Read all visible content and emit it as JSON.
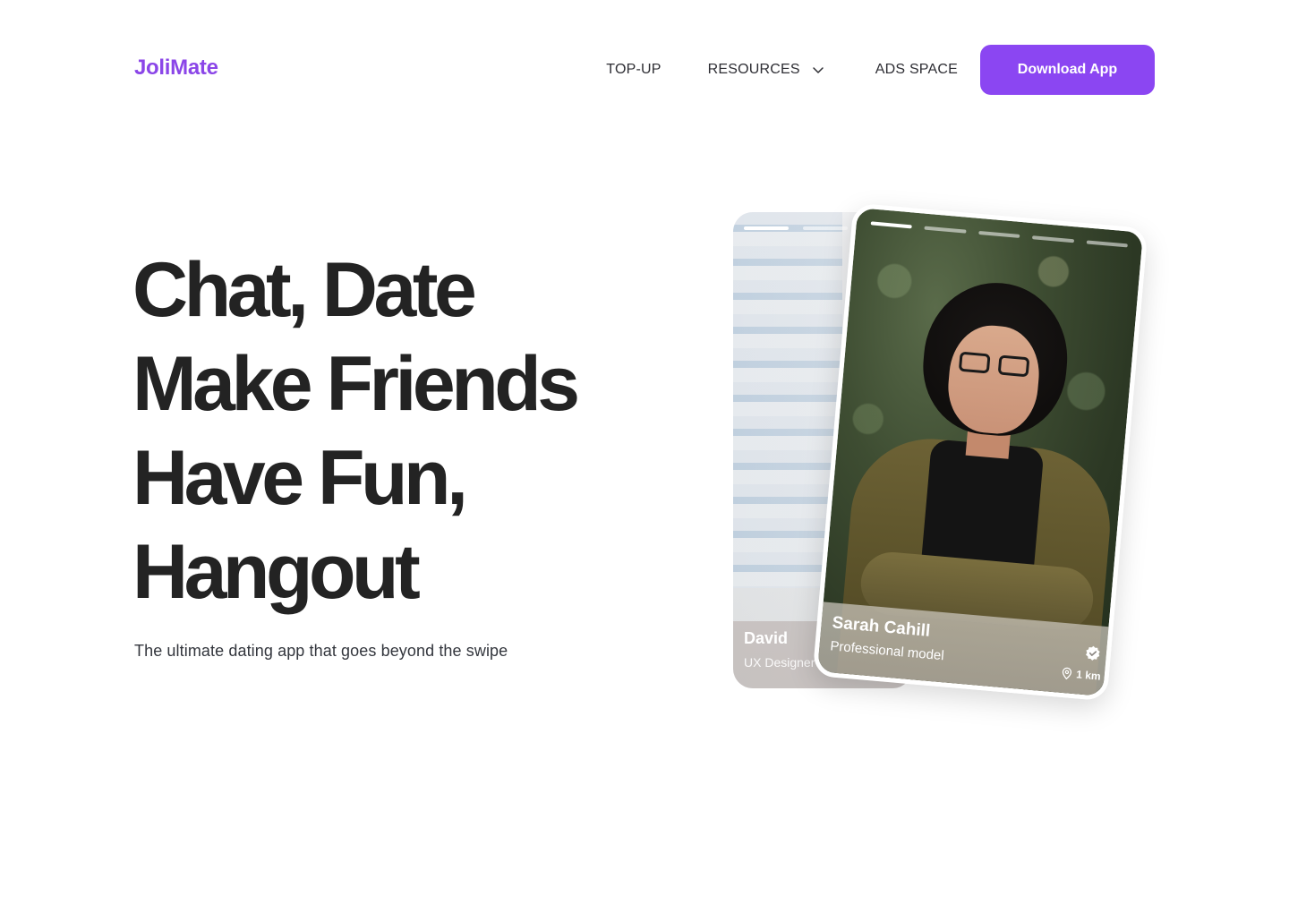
{
  "brand": {
    "logo": "JoliMate",
    "accent": "#8b46f2"
  },
  "nav": {
    "items": [
      {
        "label": "TOP-UP"
      },
      {
        "label": "RESOURCES",
        "icon": "chevron-down-icon"
      },
      {
        "label": "ADS SPACE"
      }
    ],
    "cta": "Download App"
  },
  "hero": {
    "lines": [
      "Chat, Date",
      "Make Friends",
      "Have Fun,",
      "Hangout"
    ],
    "subtitle": "The ultimate dating app that goes beyond the swipe"
  },
  "cards": {
    "back": {
      "name": "David",
      "role": "UX Designer"
    },
    "front": {
      "name": "Sarah Cahill",
      "role": "Professional model",
      "distance": "1 km",
      "verified_icon": "verified-badge-icon",
      "location_icon": "location-pin-icon",
      "story_count": 5,
      "story_active_index": 0
    }
  }
}
